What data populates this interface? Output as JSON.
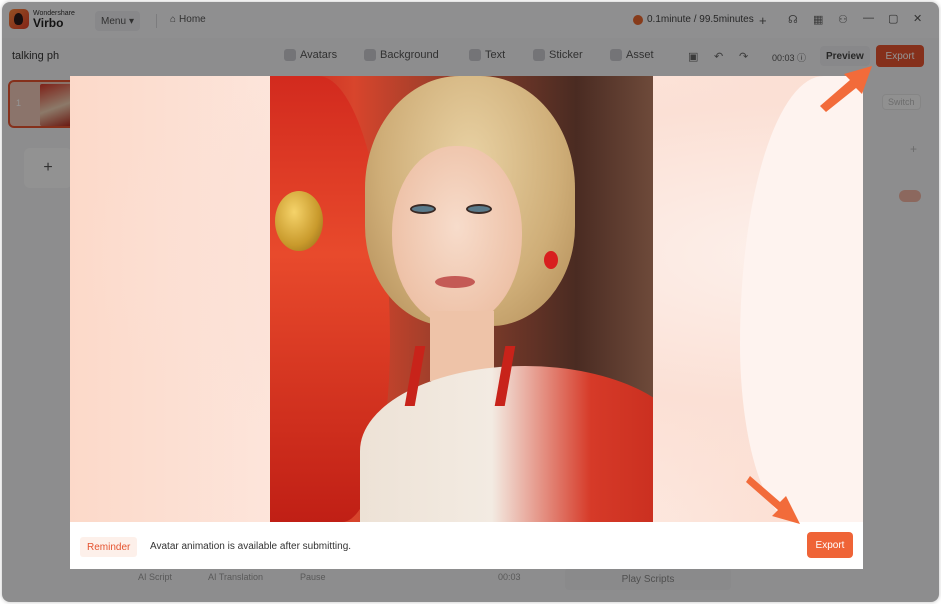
{
  "app": {
    "brand_small": "Wondershare",
    "brand_big": "Virbo",
    "menu_label": "Menu",
    "home_label": "Home",
    "credits": "0.1minute / 99.5minutes",
    "plus_label": "+"
  },
  "toolbar": {
    "project_name": "talking ph",
    "tools": [
      {
        "label": "Avatars",
        "icon": "avatar-icon"
      },
      {
        "label": "Background",
        "icon": "background-icon"
      },
      {
        "label": "Text",
        "icon": "text-icon"
      },
      {
        "label": "Sticker",
        "icon": "sticker-icon"
      },
      {
        "label": "Asset",
        "icon": "asset-icon"
      }
    ],
    "timer": "00:03",
    "preview_label": "Preview",
    "export_label": "Export"
  },
  "sidebar": {
    "scene_number": "1",
    "add_label": "+"
  },
  "right_panel": {
    "switch_label": "Switch",
    "plus_label": "+"
  },
  "bottom": {
    "ai_script": "AI Script",
    "ai_translation": "AI Translation",
    "pause": "Pause",
    "time": "00:03",
    "play_scripts": "Play Scripts"
  },
  "modal": {
    "reminder_tag": "Reminder",
    "reminder_text": "Avatar animation is available after submitting.",
    "export_label": "Export"
  },
  "colors": {
    "accent": "#e5532f",
    "arrow": "#f26b3a"
  }
}
